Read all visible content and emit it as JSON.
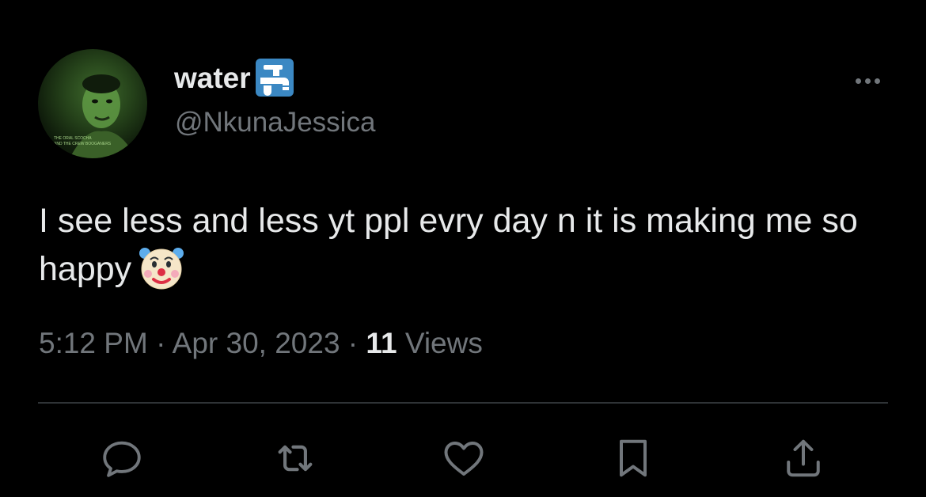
{
  "author": {
    "display_name": "water",
    "name_emoji": "potable-water-icon",
    "handle": "@NkunaJessica",
    "avatar_caption_line1": "THE ORAL SCOCHA",
    "avatar_caption_line2": "AND THE CREW BOOGANERS"
  },
  "tweet": {
    "text": "I see less and less yt ppl evry day n it is making me so happy",
    "emoji": "clown-face-icon",
    "time": "5:12 PM",
    "separator1": " · ",
    "date": "Apr 30, 2023",
    "separator2": " · ",
    "views_count": "11",
    "views_label": " Views"
  },
  "actions": [
    "reply-icon",
    "retweet-icon",
    "like-icon",
    "bookmark-icon",
    "share-icon"
  ],
  "colors": {
    "background": "#000000",
    "primary_text": "#e7e9ea",
    "secondary_text": "#71767b",
    "divider": "#2f3336"
  }
}
